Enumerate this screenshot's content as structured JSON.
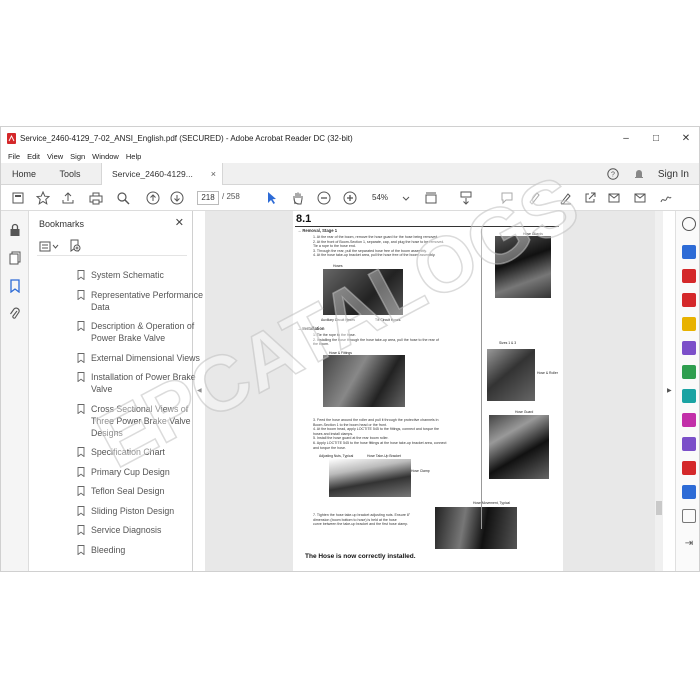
{
  "window": {
    "title": "Service_2460-4129_7-02_ANSI_English.pdf (SECURED) - Adobe Acrobat Reader DC (32-bit)",
    "minimize": "–",
    "maximize": "□",
    "close": "✕"
  },
  "menu": [
    "File",
    "Edit",
    "View",
    "Sign",
    "Window",
    "Help"
  ],
  "tabs": {
    "home": "Home",
    "tools": "Tools",
    "doc": "Service_2460-4129...",
    "doc_close": "×"
  },
  "signin": "Sign In",
  "toolbar": {
    "page_current": "218",
    "page_total": "/  258",
    "zoom": "54%"
  },
  "bookmarks": {
    "title": "Bookmarks",
    "close": "✕",
    "items": [
      "System Schematic",
      "Representative Performance Data",
      "Description & Operation of Power Brake Valve",
      "External Dimensional Views",
      "Installation of Power Brake Valve",
      "Cross Sectional Views of Three Power Brake Valve Designs",
      "Specification Chart",
      "Primary Cup Design",
      "Teflon Seal Design",
      "Sliding Piston Design",
      "Service Diagnosis",
      "Bleeding"
    ]
  },
  "page": {
    "section": "8.1",
    "removal_heading": "→ Removal, Stage 1",
    "removal_steps": [
      "1.  At the rear of the boom, remove the hose guard for the hose being removed.",
      "2.  At the front of Boom-Section 1, separate, cap, and plug the hose to be removed.",
      "     Tie a rope to the hose end.",
      "3.  Through the rear, pull the separated hose free of the boom assembly.",
      "4.  At the hose take-up bracket area, pull the hose free of the boom assembly."
    ],
    "hoses_label": "Hoses",
    "aux_label": "Auxiliary Circuit Hoses",
    "tilt_label": "Tilt Circuit Hoses",
    "install_heading": "→ Installation",
    "install_steps": [
      "1.  Tie the rope to the hose.",
      "2.  Installing the hose through the hose take-up area, pull the hose to the rear of",
      "     the boom."
    ],
    "hose_fittings": "Hose & Fittings",
    "steps_more": [
      "3.  Feed the hose around the roller and pull it through the protective channels in",
      "     Boom-Section 1 to the boom head or the front.",
      "4.  At the boom head, apply LOCTITE 545 to the fittings, connect and torque the",
      "     hoses and install clamps.",
      "5.  Install the hose guard at the rear boom roller.",
      "6.  Apply LOCTITE 545 to the hose fittings at the hose take-up bracket area, connect",
      "     and torque the hose."
    ],
    "adj_nuts": "Adjusting Nuts, Typical",
    "take_up": "Hose Take-Up Bracket",
    "hose_clamp": "Hose Clamp",
    "hose_movement": "Hose Movement, Typical",
    "step7": [
      "7.  Tighten the hose take-up bracket adjusting nuts. Ensure 8\"",
      "     dimension (boom bottom to hose) is held at the hose",
      "     curve between the take-up bracket and the first hose clamp."
    ],
    "hose_guards": "Hose Guards",
    "sizes": "Sizes 1 & 3",
    "hose_roller": "Hose & Roller",
    "hose_guard": "Hose Guard",
    "final": "The Hose is now correctly installed."
  },
  "watermark": "EPCATALOGS",
  "colors": {
    "accent_blue": "#2d6bd6",
    "pdf_red": "#d4282a"
  }
}
